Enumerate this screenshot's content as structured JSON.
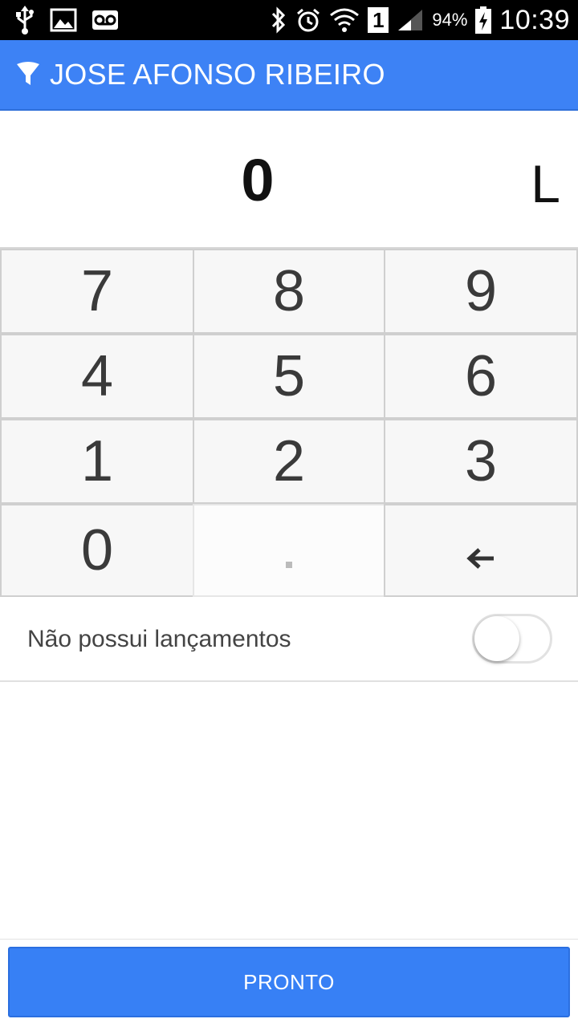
{
  "status_bar": {
    "battery_percent": "94%",
    "time": "10:39",
    "sim_slot": "1",
    "left_icons": [
      "usb-icon",
      "image-icon",
      "voicemail-icon"
    ],
    "right_icons": [
      "bluetooth-icon",
      "alarm-icon",
      "wifi-icon",
      "sim-icon",
      "signal-icon",
      "battery-charging-icon"
    ]
  },
  "app_bar": {
    "title": "JOSE AFONSO RIBEIRO",
    "icon": "filter-icon",
    "background": "#3d82f5"
  },
  "display": {
    "value": "0",
    "unit": "L"
  },
  "keypad": {
    "keys": [
      "7",
      "8",
      "9",
      "4",
      "5",
      "6",
      "1",
      "2",
      "3",
      "0",
      ".",
      "←"
    ]
  },
  "toggle": {
    "label": "Não possui lançamentos",
    "checked": false
  },
  "primary_button": {
    "label": "PRONTO",
    "background": "#3780f5"
  }
}
